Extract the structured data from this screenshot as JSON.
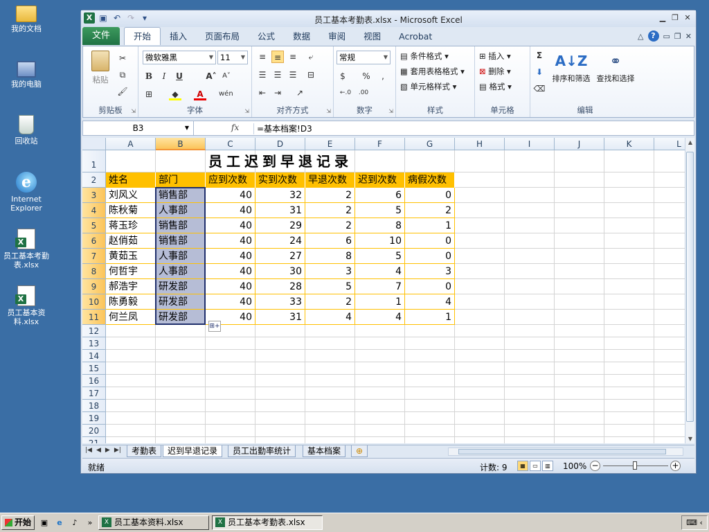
{
  "desktop": {
    "icons": [
      {
        "label": "我的文档"
      },
      {
        "label": "我的电脑"
      },
      {
        "label": "回收站"
      },
      {
        "label": "Internet Explorer"
      },
      {
        "label": "员工基本考勤表.xlsx"
      },
      {
        "label": "员工基本资料.xlsx"
      }
    ]
  },
  "window": {
    "title": "员工基本考勤表.xlsx - Microsoft Excel"
  },
  "ribbon": {
    "file_tab": "文件",
    "tabs": [
      "开始",
      "插入",
      "页面布局",
      "公式",
      "数据",
      "审阅",
      "视图",
      "Acrobat"
    ],
    "clipboard": {
      "label": "剪贴板",
      "paste": "粘贴"
    },
    "font": {
      "label": "字体",
      "name": "微软雅黑",
      "size": "11",
      "bold": "B",
      "italic": "I",
      "underline": "U"
    },
    "alignment": {
      "label": "对齐方式"
    },
    "number": {
      "label": "数字",
      "format": "常规",
      "percent": "%",
      "comma": ","
    },
    "styles": {
      "label": "样式",
      "conditional": "条件格式",
      "table": "套用表格格式",
      "cell_styles": "单元格样式"
    },
    "cells": {
      "label": "单元格",
      "insert": "插入",
      "delete": "删除",
      "format": "格式"
    },
    "editing": {
      "label": "编辑",
      "sum": "Σ",
      "sort": "排序和筛选",
      "find": "查找和选择"
    }
  },
  "formula_bar": {
    "name_box": "B3",
    "fx": "fx",
    "formula": "=基本档案!D3"
  },
  "sheet": {
    "columns": [
      "A",
      "B",
      "C",
      "D",
      "E",
      "F",
      "G",
      "H",
      "I",
      "J",
      "K",
      "L"
    ],
    "rows": [
      "1",
      "2",
      "3",
      "4",
      "5",
      "6",
      "7",
      "8",
      "9",
      "10",
      "11",
      "12",
      "13",
      "14",
      "15",
      "16",
      "17",
      "18",
      "19",
      "20",
      "21"
    ],
    "title": "员工迟到早退记录",
    "headers": [
      "姓名",
      "部门",
      "应到次数",
      "实到次数",
      "早退次数",
      "迟到次数",
      "病假次数"
    ],
    "data": [
      [
        "刘风义",
        "销售部",
        "40",
        "32",
        "2",
        "6",
        "0"
      ],
      [
        "陈秋菊",
        "人事部",
        "40",
        "31",
        "2",
        "5",
        "2"
      ],
      [
        "蒋玉珍",
        "销售部",
        "40",
        "29",
        "2",
        "8",
        "1"
      ],
      [
        "赵俏茹",
        "销售部",
        "40",
        "24",
        "6",
        "10",
        "0"
      ],
      [
        "黄茹玉",
        "人事部",
        "40",
        "27",
        "8",
        "5",
        "0"
      ],
      [
        "何哲宇",
        "人事部",
        "40",
        "30",
        "3",
        "4",
        "3"
      ],
      [
        "郝浩宇",
        "研发部",
        "40",
        "28",
        "5",
        "7",
        "0"
      ],
      [
        "陈勇毅",
        "研发部",
        "40",
        "33",
        "2",
        "1",
        "4"
      ],
      [
        "何兰凤",
        "研发部",
        "40",
        "31",
        "4",
        "4",
        "1"
      ]
    ],
    "tabs": [
      "考勤表",
      "迟到早退记录",
      "员工出勤率统计",
      "基本档案"
    ],
    "active_tab_index": 1
  },
  "status": {
    "ready": "就绪",
    "count": "计数: 9",
    "zoom": "100%"
  },
  "taskbar": {
    "start": "开始",
    "tasks": [
      "员工基本资料.xlsx",
      "员工基本考勤表.xlsx"
    ]
  },
  "colors": {
    "header_fill": "#ffc000",
    "selection": "#b6bdd6",
    "excel_green": "#1f7244"
  }
}
